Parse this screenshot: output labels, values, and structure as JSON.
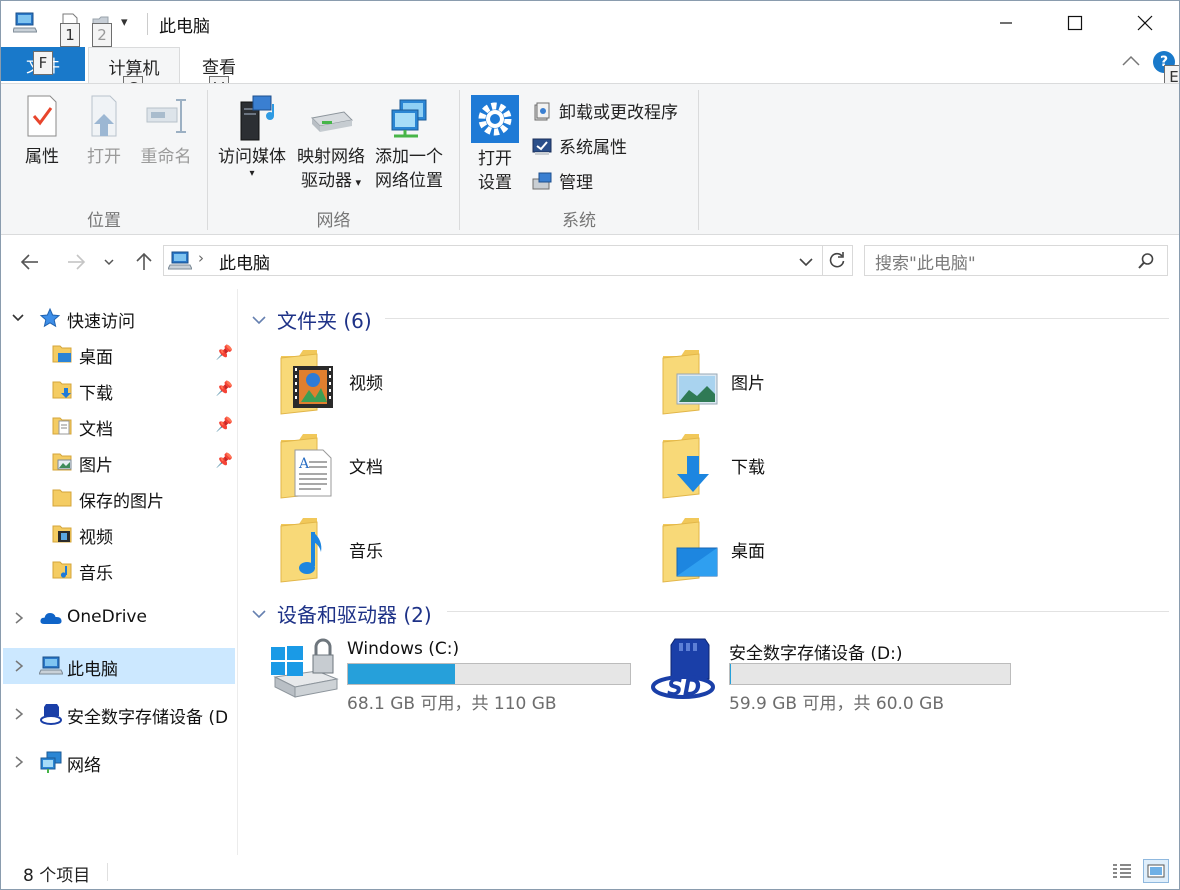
{
  "titlebar": {
    "title": "此电脑",
    "keytips": [
      "1",
      "2"
    ]
  },
  "ribbon_tabs": {
    "file": "文件",
    "file_keytip": "F",
    "computer": "计算机",
    "computer_keytip": "C",
    "view": "查看",
    "view_keytip": "V",
    "help_keytip": "E"
  },
  "ribbon": {
    "location": {
      "label": "位置",
      "properties": "属性",
      "open": "打开",
      "rename": "重命名"
    },
    "network": {
      "label": "网络",
      "access_media": "访问媒体",
      "map_drive_1": "映射网络",
      "map_drive_2": "驱动器",
      "add_location_1": "添加一个",
      "add_location_2": "网络位置"
    },
    "system": {
      "label": "系统",
      "open_settings_1": "打开",
      "open_settings_2": "设置",
      "uninstall": "卸载或更改程序",
      "system_properties": "系统属性",
      "manage": "管理"
    }
  },
  "address": {
    "path": "此电脑",
    "search_placeholder": "搜索\"此电脑\""
  },
  "nav": {
    "quick_access": "快速访问",
    "items": [
      {
        "label": "桌面",
        "pinned": true
      },
      {
        "label": "下载",
        "pinned": true
      },
      {
        "label": "文档",
        "pinned": true
      },
      {
        "label": "图片",
        "pinned": true
      },
      {
        "label": "保存的图片",
        "pinned": false
      },
      {
        "label": "视频",
        "pinned": false
      },
      {
        "label": "音乐",
        "pinned": false
      }
    ],
    "onedrive": "OneDrive",
    "this_pc": "此电脑",
    "sd_device": "安全数字存储设备 (D",
    "network": "网络"
  },
  "content": {
    "folders_header": "文件夹 (6)",
    "folders": [
      "视频",
      "图片",
      "文档",
      "下载",
      "音乐",
      "桌面"
    ],
    "drives_header": "设备和驱动器 (2)",
    "drives": [
      {
        "name": "Windows (C:)",
        "info": "68.1 GB 可用，共 110 GB",
        "used_fraction": 0.381
      },
      {
        "name": "安全数字存储设备 (D:)",
        "info": "59.9 GB 可用，共 60.0 GB",
        "used_fraction": 0.002
      }
    ]
  },
  "status": {
    "count": "8 个项目"
  },
  "colors": {
    "accent": "#1979ca",
    "header_text": "#1e3287",
    "selection": "#cce8ff",
    "drive_fill": "#26a0da"
  }
}
